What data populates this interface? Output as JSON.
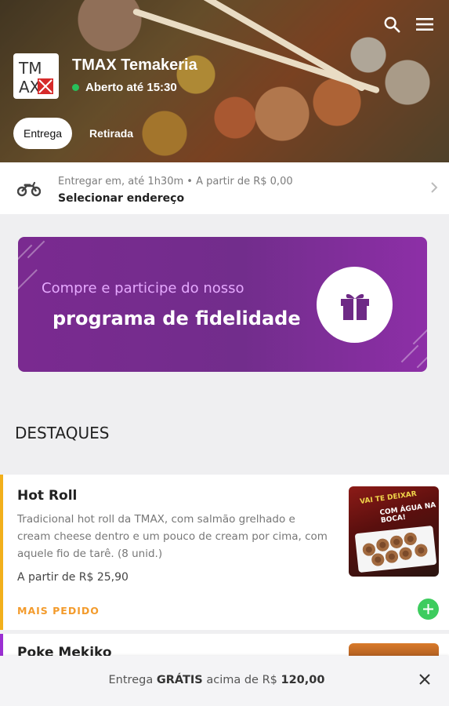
{
  "header": {
    "restaurant_name": "TMAX Temakeria",
    "status": "Aberto até 15:30",
    "status_color": "#27c15b",
    "logo_text_top": "TM",
    "logo_text_bottom": "AX",
    "search_icon": "search-icon",
    "menu_icon": "hamburger-menu-icon"
  },
  "tabs": [
    {
      "label": "Entrega",
      "active": true
    },
    {
      "label": "Retirada",
      "active": false
    }
  ],
  "delivery": {
    "info": "Entregar em, até 1h30m  •  A partir de R$ 0,00",
    "address_label": "Selecionar endereço",
    "icon": "motorcycle-icon"
  },
  "promo": {
    "line1": "Compre e participe do nosso",
    "line2": "programa de fidelidade",
    "icon": "gift-icon"
  },
  "section_title": "DESTAQUES",
  "items": [
    {
      "name": "Hot Roll",
      "description": "Tradicional hot roll da TMAX, com salmão grelhado e cream cheese dentro e um pouco de cream por cima, com aquele fio de tarê. (8 unid.)",
      "price": "A partir de R$ 25,90",
      "tag": "MAIS PEDIDO",
      "image_text_1": "VAI TE DEIXAR",
      "image_text_2": "COM ÁGUA NA BOCA!",
      "accent_color": "#f2b01c"
    },
    {
      "name": "Poke Mekiko",
      "accent_color": "#9b2fd2"
    }
  ],
  "footer": {
    "text_before": "Entrega ",
    "text_bold": "GRÁTIS",
    "text_after": " acima de R$ ",
    "amount": "120,00"
  }
}
